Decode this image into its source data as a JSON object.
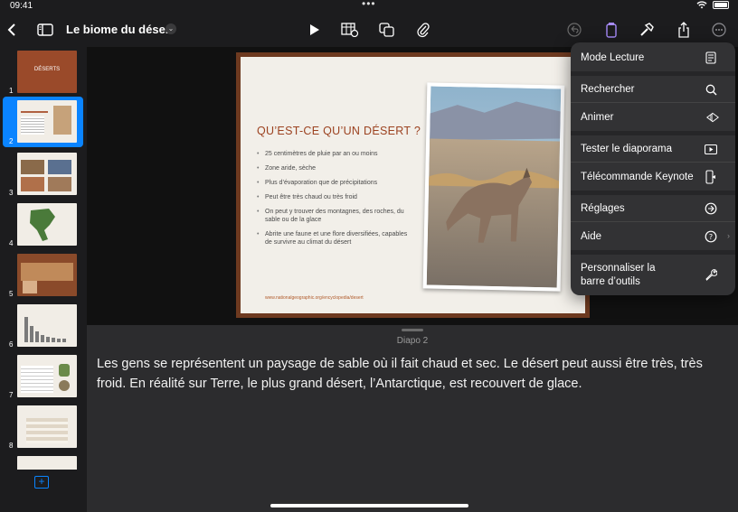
{
  "status_bar": {
    "time": "09:41"
  },
  "toolbar": {
    "title": "Le biome du désert"
  },
  "navigator": {
    "slide_numbers": [
      "1",
      "2",
      "3",
      "4",
      "5",
      "6",
      "7",
      "8"
    ],
    "thumb1_title": "DÉSERTS"
  },
  "slide": {
    "title": "QU’EST-CE QU’UN DÉSERT ?",
    "bullets": [
      "25 centimètres de pluie par an ou moins",
      "Zone aride, sèche",
      "Plus d’évaporation que de précipitations",
      "Peut être très chaud ou très froid",
      "On peut y trouver des montagnes, des roches, du sable ou de la glace",
      "Abrite une faune et une flore diversifiées, capables de survivre au climat du désert"
    ],
    "link": "www.nationalgeographic.org/encyclopedia/desert"
  },
  "notes": {
    "slide_label": "Diapo 2",
    "text": "Les gens se représentent un paysage de sable où il fait chaud et sec. Le désert peut aussi être très, très froid. En réalité sur Terre, le plus grand désert, l’Antarctique, est recouvert de glace."
  },
  "menu": {
    "items": [
      "Mode Lecture",
      "Rechercher",
      "Animer",
      "Tester le diaporama",
      "Télécommande Keynote",
      "Réglages",
      "Aide",
      "Personnaliser la barre d’outils"
    ]
  },
  "colors": {
    "accent": "#0a84ff",
    "slide_frame": "#6e3a20",
    "slide_title": "#9c4220",
    "purple_icon": "#a78bfa"
  }
}
